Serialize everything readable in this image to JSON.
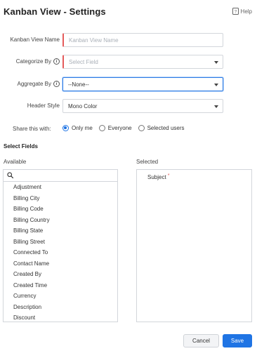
{
  "header": {
    "title": "Kanban View - Settings",
    "help_label": "Help"
  },
  "form": {
    "kanban_view_name": {
      "label": "Kanban View Name",
      "placeholder": "Kanban View Name",
      "value": ""
    },
    "categorize_by": {
      "label": "Categorize By",
      "placeholder": "Select Field",
      "value": ""
    },
    "aggregate_by": {
      "label": "Aggregate By",
      "value": "--None--"
    },
    "header_style": {
      "label": "Header Style",
      "value": "Mono Color"
    },
    "share": {
      "label": "Share this with:",
      "options": [
        "Only me",
        "Everyone",
        "Selected users"
      ],
      "selected": "Only me"
    }
  },
  "select_fields": {
    "title": "Select Fields",
    "available_label": "Available",
    "selected_label": "Selected",
    "search_placeholder": "",
    "available": [
      "Adjustment",
      "Billing City",
      "Billing Code",
      "Billing Country",
      "Billing State",
      "Billing Street",
      "Connected To",
      "Contact Name",
      "Created By",
      "Created Time",
      "Currency",
      "Description",
      "Discount"
    ],
    "selected": [
      {
        "label": "Subject",
        "required_mark": "*"
      }
    ]
  },
  "actions": {
    "cancel_label": "Cancel",
    "save_label": "Save"
  },
  "colors": {
    "primary": "#1f74e4",
    "mandatory": "#e45a5a",
    "border": "#d3d6db"
  },
  "icons": {
    "help": "help-book-icon",
    "info": "info-icon",
    "dropdown": "chevron-down-icon",
    "search": "search-icon"
  }
}
